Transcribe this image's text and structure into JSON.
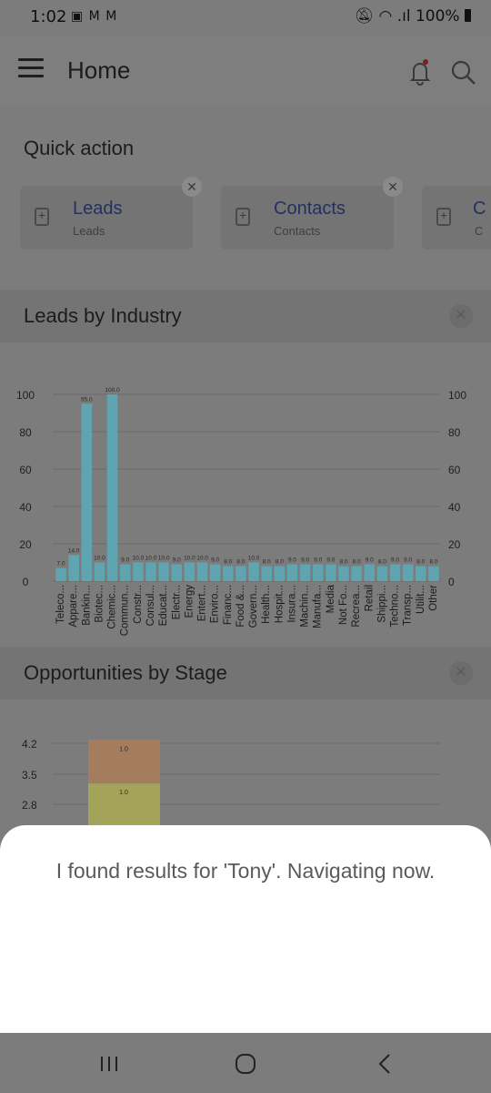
{
  "status": {
    "time": "1:02",
    "left_icons": "▣ M M",
    "battery": "100%"
  },
  "header": {
    "title": "Home"
  },
  "quick_action": {
    "title": "Quick action",
    "cards": [
      {
        "title": "Leads",
        "subtitle": "Leads"
      },
      {
        "title": "Contacts",
        "subtitle": "Contacts"
      },
      {
        "title": "C",
        "subtitle": "C"
      }
    ]
  },
  "leads_by_industry": {
    "title": "Leads by Industry",
    "close": "×"
  },
  "opportunities_by_stage": {
    "title": "Opportunities by Stage",
    "close": "×"
  },
  "sheet": {
    "message": "I found results for 'Tony'. Navigating now."
  },
  "colors": {
    "bar": "#5fa4b1",
    "stage_top": "#a47d5f",
    "stage_bottom": "#a4a35a",
    "link": "#24305e"
  },
  "chart_data": [
    {
      "type": "bar",
      "title": "Leads by Industry",
      "categories": [
        "Teleco...",
        "Appare...",
        "Bankin...",
        "Biotec...",
        "Chemic...",
        "Commun...",
        "Constr...",
        "Consul...",
        "Educat...",
        "Electr...",
        "Energy",
        "Entert...",
        "Enviro...",
        "Financ...",
        "Food &...",
        "Govern...",
        "Health...",
        "Hospit...",
        "Insura...",
        "Machin...",
        "Manufa...",
        "Media",
        "Not Fo...",
        "Recrea...",
        "Retail",
        "Shippi...",
        "Techno...",
        "Transp...",
        "Utilit...",
        "Other"
      ],
      "values": [
        7.0,
        14.0,
        95.0,
        10.0,
        100.0,
        9.0,
        10.0,
        10.0,
        10.0,
        9.0,
        10.0,
        10.0,
        9.0,
        8.0,
        8.0,
        10.0,
        8.0,
        8.0,
        9.0,
        9.0,
        9.0,
        9.0,
        8.0,
        8.0,
        9.0,
        8.0,
        9.0,
        9.0,
        8.0,
        8.0
      ],
      "ylim": [
        0,
        100
      ],
      "yticks": [
        0,
        20,
        40,
        60,
        80,
        100
      ]
    },
    {
      "type": "bar",
      "title": "Opportunities by Stage",
      "yticks": [
        "4.2",
        "3.5",
        "2.8"
      ],
      "series": [
        {
          "values": [
            1.0
          ]
        },
        {
          "values": [
            1.0
          ]
        }
      ]
    }
  ]
}
